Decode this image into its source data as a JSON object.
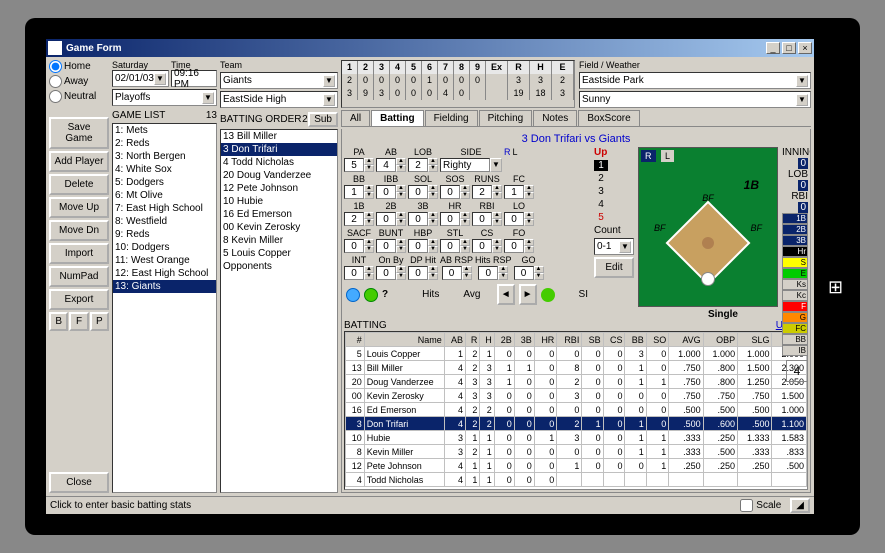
{
  "window": {
    "title": "Game Form"
  },
  "left": {
    "home": "Home",
    "away": "Away",
    "neutral": "Neutral",
    "save": "Save Game",
    "add": "Add Player",
    "delete": "Delete",
    "moveup": "Move Up",
    "movedn": "Move Dn",
    "import": "Import",
    "numpad": "NumPad",
    "export": "Export",
    "b": "B",
    "f": "F",
    "p": "P",
    "close": "Close"
  },
  "col2": {
    "saturday_label": "Saturday",
    "time_label": "Time",
    "date": "02/01/03",
    "time": "09:16 PM",
    "gametype": "Playoffs",
    "gamelist_label": "GAME LIST",
    "gamelist_count": "13",
    "games": [
      "1: Mets",
      "2: Reds",
      "3: North Bergen",
      "4: White Sox",
      "5: Dodgers",
      "6: Mt Olive",
      "7: East High School",
      "8: Westfield",
      "9: Reds",
      "10: Dodgers",
      "11: West Orange",
      "12: East High School",
      "13: Giants"
    ],
    "selected_game": 12
  },
  "col3": {
    "team_label": "Team",
    "team": "Giants",
    "opp": "EastSide High",
    "batorder_label": "BATTING ORDER",
    "batorder_num": "2",
    "sub": "Sub",
    "batters": [
      "13 Bill Miller",
      "3 Don Trifari",
      "4 Todd Nicholas",
      "20 Doug Vanderzee",
      "12 Pete Johnson",
      "10 Hubie",
      "16 Ed Emerson",
      "00 Kevin Zerosky",
      "8 Kevin Miller",
      "5 Louis Copper",
      "Opponents"
    ],
    "selected_batter": 1
  },
  "score": {
    "innings": [
      "1",
      "2",
      "3",
      "4",
      "5",
      "6",
      "7",
      "8",
      "9",
      "Ex",
      "R",
      "H",
      "E"
    ],
    "away": [
      "2",
      "0",
      "0",
      "0",
      "0",
      "1",
      "0",
      "0",
      "0",
      "",
      "3",
      "3",
      "2"
    ],
    "home": [
      "3",
      "9",
      "3",
      "0",
      "0",
      "0",
      "4",
      "0",
      "",
      "",
      "19",
      "18",
      "3"
    ],
    "fw_label": "Field / Weather",
    "field": "Eastside Park",
    "weather": "Sunny"
  },
  "tabs": {
    "all": "All",
    "batting": "Batting",
    "fielding": "Fielding",
    "pitching": "Pitching",
    "notes": "Notes",
    "box": "BoxScore"
  },
  "matchup": "3 Don Trifari vs Giants",
  "stats": {
    "row1": [
      "PA",
      "AB",
      "LOB",
      "SIDE",
      "R",
      "L"
    ],
    "row1v": [
      "5",
      "4",
      "2",
      "Righty",
      "",
      ""
    ],
    "row2": [
      "BB",
      "IBB",
      "SOL",
      "SOS",
      "RUNS",
      "FC"
    ],
    "row2v": [
      "1",
      "0",
      "0",
      "0",
      "2",
      "1"
    ],
    "row3": [
      "1B",
      "2B",
      "3B",
      "HR",
      "RBI",
      "LO"
    ],
    "row3v": [
      "2",
      "0",
      "0",
      "0",
      "0",
      "0"
    ],
    "row4": [
      "SACF",
      "BUNT",
      "HBP",
      "STL",
      "CS",
      "FO"
    ],
    "row4v": [
      "0",
      "0",
      "0",
      "0",
      "0",
      "0"
    ],
    "row5": [
      "INT",
      "On By",
      "DP Hit",
      "AB RSP",
      "Hits RSP",
      "GO"
    ],
    "row5v": [
      "0",
      "0",
      "0",
      "0",
      "0",
      "0"
    ],
    "up": "Up",
    "count": "Count",
    "count_val": "0-1",
    "edit": "Edit",
    "pitches": [
      "1",
      "2",
      "3",
      "4",
      "5"
    ]
  },
  "field_panel": {
    "r": "R",
    "l": "L",
    "pos": "1B",
    "single": "Single",
    "inning": "INNING",
    "inning_v": "0",
    "lob": "LOB",
    "lob_v": "0",
    "rbi": "RBI",
    "rbi_v": "0",
    "side_labels": [
      "1B",
      "2B",
      "3B",
      "Hr",
      "S",
      "E",
      "Ks",
      "Kc",
      "F",
      "G",
      "FC",
      "BB",
      "IB"
    ],
    "hits": "Hits",
    "avg": "Avg",
    "si": "SI",
    "big4": "4"
  },
  "batting_table": {
    "header": "BATTING",
    "update": "Update",
    "cols": [
      "#",
      "Name",
      "AB",
      "R",
      "H",
      "2B",
      "3B",
      "HR",
      "RBI",
      "SB",
      "CS",
      "BB",
      "SO",
      "AVG",
      "OBP",
      "SLG",
      "OPS"
    ],
    "rows": [
      [
        "5",
        "Louis Copper",
        "1",
        "2",
        "1",
        "0",
        "0",
        "0",
        "0",
        "0",
        "0",
        "3",
        "0",
        "1.000",
        "1.000",
        "1.000",
        "2.000"
      ],
      [
        "13",
        "Bill Miller",
        "4",
        "2",
        "3",
        "1",
        "1",
        "0",
        "8",
        "0",
        "0",
        "1",
        "0",
        ".750",
        ".800",
        "1.500",
        "2.300"
      ],
      [
        "20",
        "Doug Vanderzee",
        "4",
        "3",
        "3",
        "1",
        "0",
        "0",
        "2",
        "0",
        "0",
        "1",
        "1",
        ".750",
        ".800",
        "1.250",
        "2.050"
      ],
      [
        "00",
        "Kevin Zerosky",
        "4",
        "3",
        "3",
        "0",
        "0",
        "0",
        "3",
        "0",
        "0",
        "0",
        "0",
        ".750",
        ".750",
        ".750",
        "1.500"
      ],
      [
        "16",
        "Ed Emerson",
        "4",
        "2",
        "2",
        "0",
        "0",
        "0",
        "0",
        "0",
        "0",
        "0",
        "0",
        ".500",
        ".500",
        ".500",
        "1.000"
      ],
      [
        "3",
        "Don Trifari",
        "4",
        "2",
        "2",
        "0",
        "0",
        "0",
        "2",
        "1",
        "0",
        "1",
        "0",
        ".500",
        ".600",
        ".500",
        "1.100"
      ],
      [
        "10",
        "Hubie",
        "3",
        "1",
        "1",
        "0",
        "0",
        "1",
        "3",
        "0",
        "0",
        "1",
        "1",
        ".333",
        ".250",
        "1.333",
        "1.583"
      ],
      [
        "8",
        "Kevin Miller",
        "3",
        "2",
        "1",
        "0",
        "0",
        "0",
        "0",
        "0",
        "0",
        "1",
        "1",
        ".333",
        ".500",
        ".333",
        ".833"
      ],
      [
        "12",
        "Pete Johnson",
        "4",
        "1",
        "1",
        "0",
        "0",
        "0",
        "1",
        "0",
        "0",
        "0",
        "1",
        ".250",
        ".250",
        ".250",
        ".500"
      ],
      [
        "4",
        "Todd Nicholas",
        "4",
        "1",
        "1",
        "0",
        "0",
        "0",
        "",
        "",
        "",
        "",
        "",
        "",
        "",
        "",
        ""
      ]
    ],
    "selected": 5
  },
  "status": {
    "msg": "Click to enter basic batting stats",
    "scale": "Scale"
  }
}
